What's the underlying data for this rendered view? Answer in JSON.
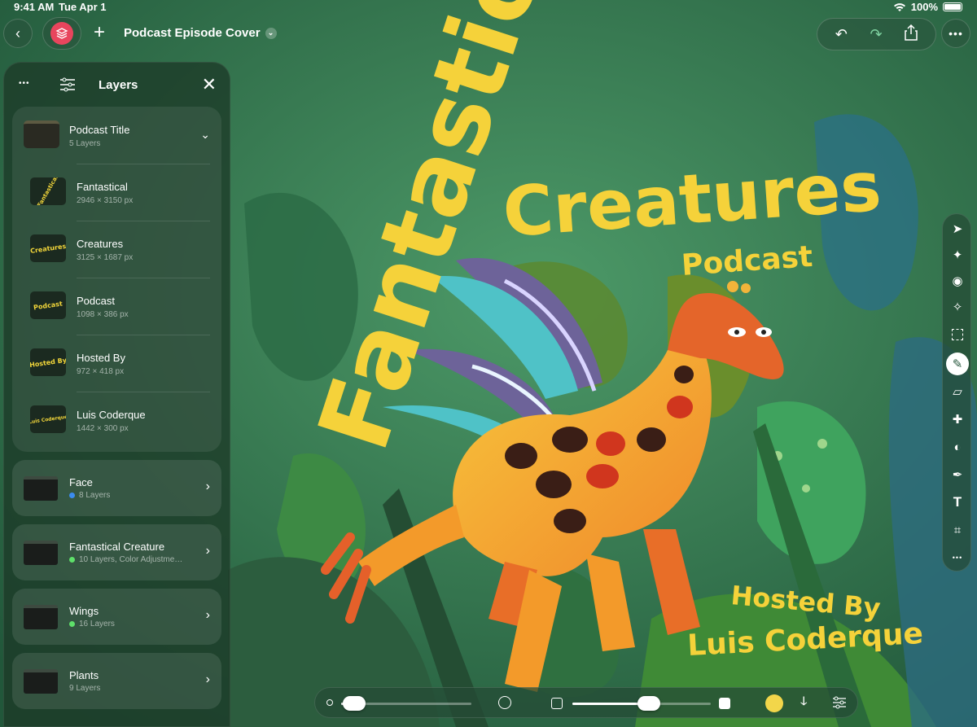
{
  "status_bar": {
    "time": "9:41 AM",
    "date": "Tue Apr 1",
    "battery": "100%"
  },
  "toolbar": {
    "document_title": "Podcast Episode Cover"
  },
  "artwork": {
    "title_line1": "Fantastical",
    "title_line2": "Creatures",
    "title_line3": "Podcast",
    "hosted_by": "Hosted By",
    "host_name": "Luis Coderque"
  },
  "layers_panel": {
    "title": "Layers",
    "open_group": {
      "name": "Podcast Title",
      "count": "5 Layers",
      "children": [
        {
          "name": "Fantastical",
          "size": "2946 × 3150 px",
          "thumb": "Fantastical"
        },
        {
          "name": "Creatures",
          "size": "3125 × 1687 px",
          "thumb": "Creatures"
        },
        {
          "name": "Podcast",
          "size": "1098 × 386 px",
          "thumb": "Podcast"
        },
        {
          "name": "Hosted By",
          "size": "972 × 418 px",
          "thumb": "Hosted By"
        },
        {
          "name": "Luis Coderque",
          "size": "1442 × 300 px",
          "thumb": "Luis Coderque"
        }
      ]
    },
    "groups": [
      {
        "name": "Face",
        "detail": "8 Layers",
        "dot_color": "#3b8cf0"
      },
      {
        "name": "Fantastical Creature",
        "detail": "10 Layers, Color Adjustme…",
        "dot_color": "#5ee06a"
      },
      {
        "name": "Wings",
        "detail": "16 Layers",
        "dot_color": "#5ee06a"
      },
      {
        "name": "Plants",
        "detail": "9 Layers",
        "dot_color": ""
      }
    ]
  },
  "tools": [
    "pointer-icon",
    "paint-brush-icon",
    "blend-icon",
    "magic-wand-icon",
    "selection-icon",
    "brush-icon",
    "eraser-icon",
    "bandage-icon",
    "fill-icon",
    "pen-icon",
    "text-icon",
    "crop-icon",
    "more-icon"
  ],
  "bottom_bar": {
    "brush_size": 0.1,
    "opacity": 0.55,
    "color": "#f2d64a"
  },
  "colors": {
    "accent": "#f2d63a",
    "layer_badge": "#e8455d"
  }
}
